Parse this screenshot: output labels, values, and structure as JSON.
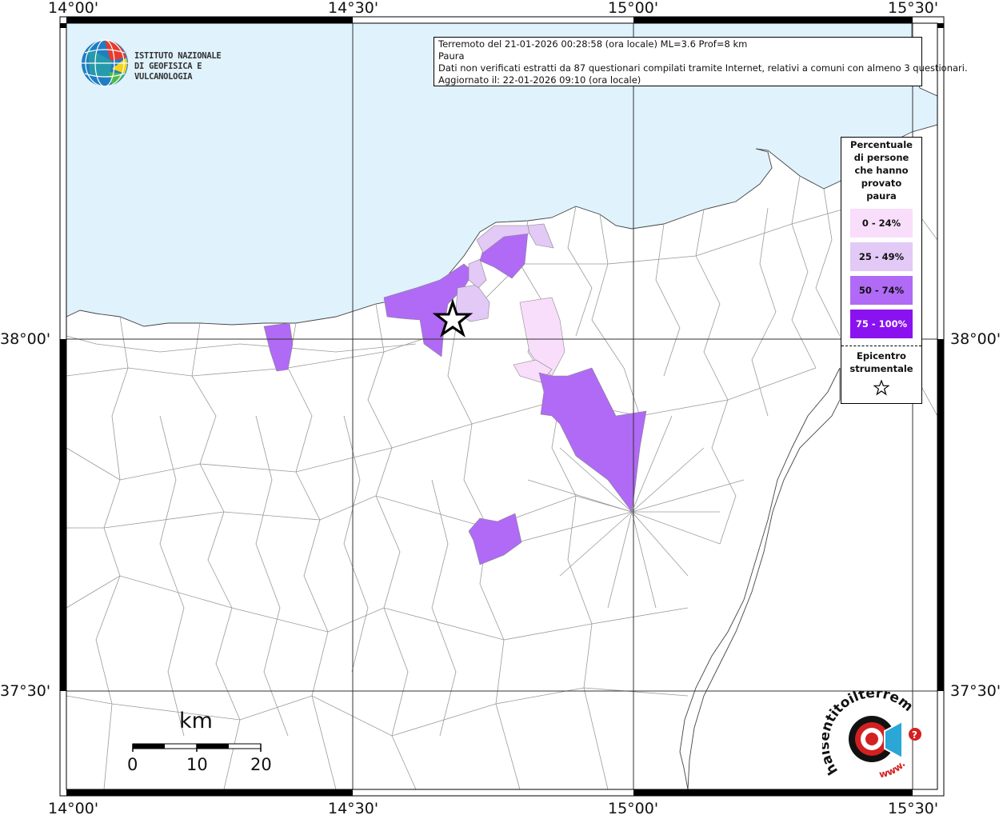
{
  "grid": {
    "top_labels": [
      "14°00'",
      "14°30'",
      "15°00'",
      "15°30'"
    ],
    "bottom_labels": [
      "14°00'",
      "14°30'",
      "15°00'",
      "15°30'"
    ],
    "left_labels": [
      "38°00'",
      "37°30'"
    ],
    "right_labels": [
      "38°00'",
      "37°30'"
    ]
  },
  "info": {
    "line1": "Terremoto del 21-01-2026 00:28:58 (ora locale) ML=3.6 Prof=8 km",
    "line2": "Paura",
    "line3": "Dati non verificati estratti da 87 questionari compilati tramite Internet, relativi a comuni con almeno 3 questionari.",
    "line4": "Aggiornato il: 22-01-2026 09:10 (ora locale)"
  },
  "legend": {
    "title": [
      "Percentuale",
      "di persone",
      "che hanno",
      "provato",
      "paura"
    ],
    "classes": [
      {
        "label": "0 - 24%",
        "color": "#f8defa",
        "text_color": "#111111"
      },
      {
        "label": "25 - 49%",
        "color": "#e2c9f6",
        "text_color": "#111111"
      },
      {
        "label": "50 - 74%",
        "color": "#b06af5",
        "text_color": "#111111"
      },
      {
        "label": "75 - 100%",
        "color": "#8a12f0",
        "text_color": "#ffffff"
      }
    ],
    "epicenter_title": [
      "Epicentro",
      "strumentale"
    ]
  },
  "logo_ingv": {
    "line1": "ISTITUTO NAZIONALE",
    "line2": "DI GEOFISICA E VULCANOLOGIA"
  },
  "scale_bar": {
    "unit": "km",
    "ticks": [
      "0",
      "10",
      "20"
    ]
  },
  "logo_hst": {
    "text": "haisentitoilterremoto.it",
    "url_text": "www."
  },
  "colors": {
    "sea": "#e0f2fc",
    "land": "#ffffff",
    "border_lines": "#9a9a9a",
    "frame": "#000000"
  }
}
